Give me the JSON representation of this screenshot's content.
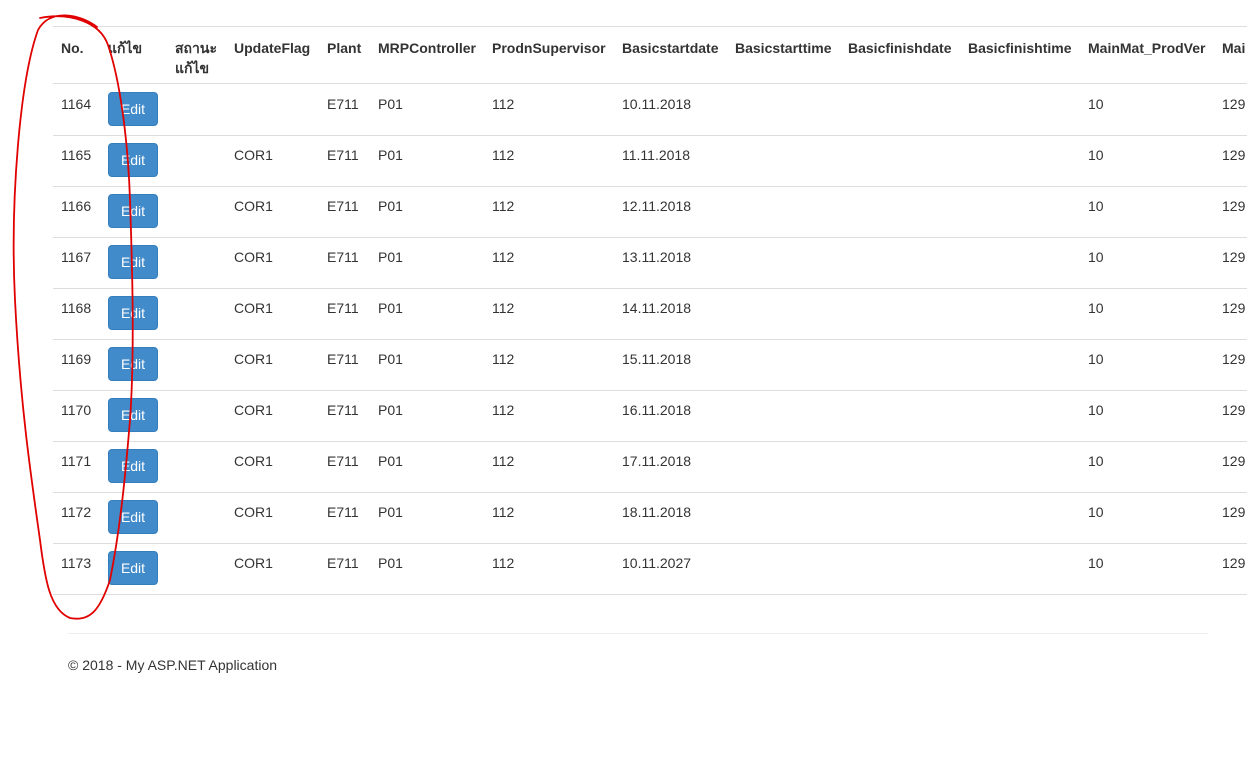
{
  "table": {
    "headers": [
      "No.",
      "แก้ไข",
      "สถานะแก้ไข",
      "UpdateFlag",
      "Plant",
      "MRPController",
      "ProdnSupervisor",
      "Basicstartdate",
      "Basicstarttime",
      "Basicfinishdate",
      "Basicfinishtime",
      "MainMat_ProdVer",
      "Mai"
    ],
    "edit_label": "Edit",
    "rows": [
      {
        "no": "1164",
        "status": "",
        "flag": "",
        "plant": "E711",
        "mrp": "P01",
        "sup": "112",
        "start": "10.11.2018",
        "stime": "",
        "fdate": "",
        "ftime": "",
        "ver": "10",
        "main": "129"
      },
      {
        "no": "1165",
        "status": "",
        "flag": "COR1",
        "plant": "E711",
        "mrp": "P01",
        "sup": "112",
        "start": "11.11.2018",
        "stime": "",
        "fdate": "",
        "ftime": "",
        "ver": "10",
        "main": "129"
      },
      {
        "no": "1166",
        "status": "",
        "flag": "COR1",
        "plant": "E711",
        "mrp": "P01",
        "sup": "112",
        "start": "12.11.2018",
        "stime": "",
        "fdate": "",
        "ftime": "",
        "ver": "10",
        "main": "129"
      },
      {
        "no": "1167",
        "status": "",
        "flag": "COR1",
        "plant": "E711",
        "mrp": "P01",
        "sup": "112",
        "start": "13.11.2018",
        "stime": "",
        "fdate": "",
        "ftime": "",
        "ver": "10",
        "main": "129"
      },
      {
        "no": "1168",
        "status": "",
        "flag": "COR1",
        "plant": "E711",
        "mrp": "P01",
        "sup": "112",
        "start": "14.11.2018",
        "stime": "",
        "fdate": "",
        "ftime": "",
        "ver": "10",
        "main": "129"
      },
      {
        "no": "1169",
        "status": "",
        "flag": "COR1",
        "plant": "E711",
        "mrp": "P01",
        "sup": "112",
        "start": "15.11.2018",
        "stime": "",
        "fdate": "",
        "ftime": "",
        "ver": "10",
        "main": "129"
      },
      {
        "no": "1170",
        "status": "",
        "flag": "COR1",
        "plant": "E711",
        "mrp": "P01",
        "sup": "112",
        "start": "16.11.2018",
        "stime": "",
        "fdate": "",
        "ftime": "",
        "ver": "10",
        "main": "129"
      },
      {
        "no": "1171",
        "status": "",
        "flag": "COR1",
        "plant": "E711",
        "mrp": "P01",
        "sup": "112",
        "start": "17.11.2018",
        "stime": "",
        "fdate": "",
        "ftime": "",
        "ver": "10",
        "main": "129"
      },
      {
        "no": "1172",
        "status": "",
        "flag": "COR1",
        "plant": "E711",
        "mrp": "P01",
        "sup": "112",
        "start": "18.11.2018",
        "stime": "",
        "fdate": "",
        "ftime": "",
        "ver": "10",
        "main": "129"
      },
      {
        "no": "1173",
        "status": "",
        "flag": "COR1",
        "plant": "E711",
        "mrp": "P01",
        "sup": "112",
        "start": "10.11.2027",
        "stime": "",
        "fdate": "",
        "ftime": "",
        "ver": "10",
        "main": "129"
      }
    ]
  },
  "footer": {
    "text": "© 2018 - My ASP.NET Application"
  },
  "colors": {
    "button": "#428bca",
    "annotation": "#e00000",
    "border": "#dddddd"
  }
}
